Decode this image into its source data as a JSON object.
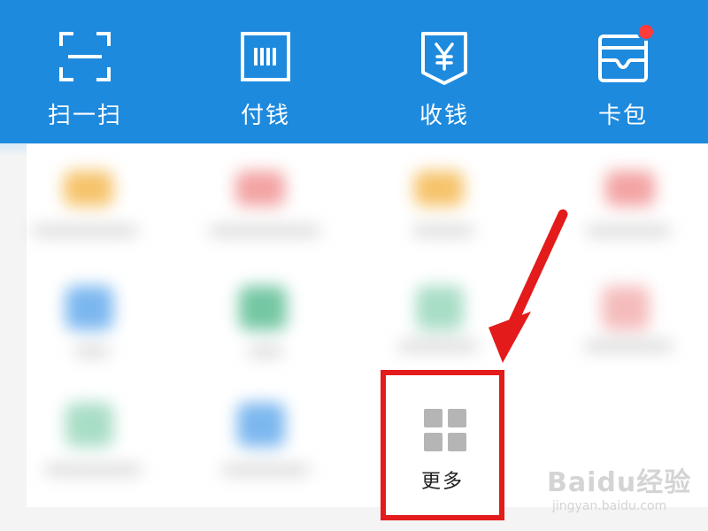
{
  "top_actions": [
    {
      "label": "扫一扫",
      "icon": "scan-icon"
    },
    {
      "label": "付钱",
      "icon": "pay-code-icon"
    },
    {
      "label": "收钱",
      "icon": "receive-money-icon"
    },
    {
      "label": "卡包",
      "icon": "card-wallet-icon",
      "badge": true
    }
  ],
  "more_button": {
    "label": "更多",
    "icon": "grid-icon"
  },
  "annotation": {
    "highlight_color": "#e31b1b"
  },
  "watermark": {
    "main": "Baidu经验",
    "sub": "jingyan.baidu.com"
  },
  "colors": {
    "topbar": "#1e8ade",
    "badge": "#ff3b3b"
  }
}
